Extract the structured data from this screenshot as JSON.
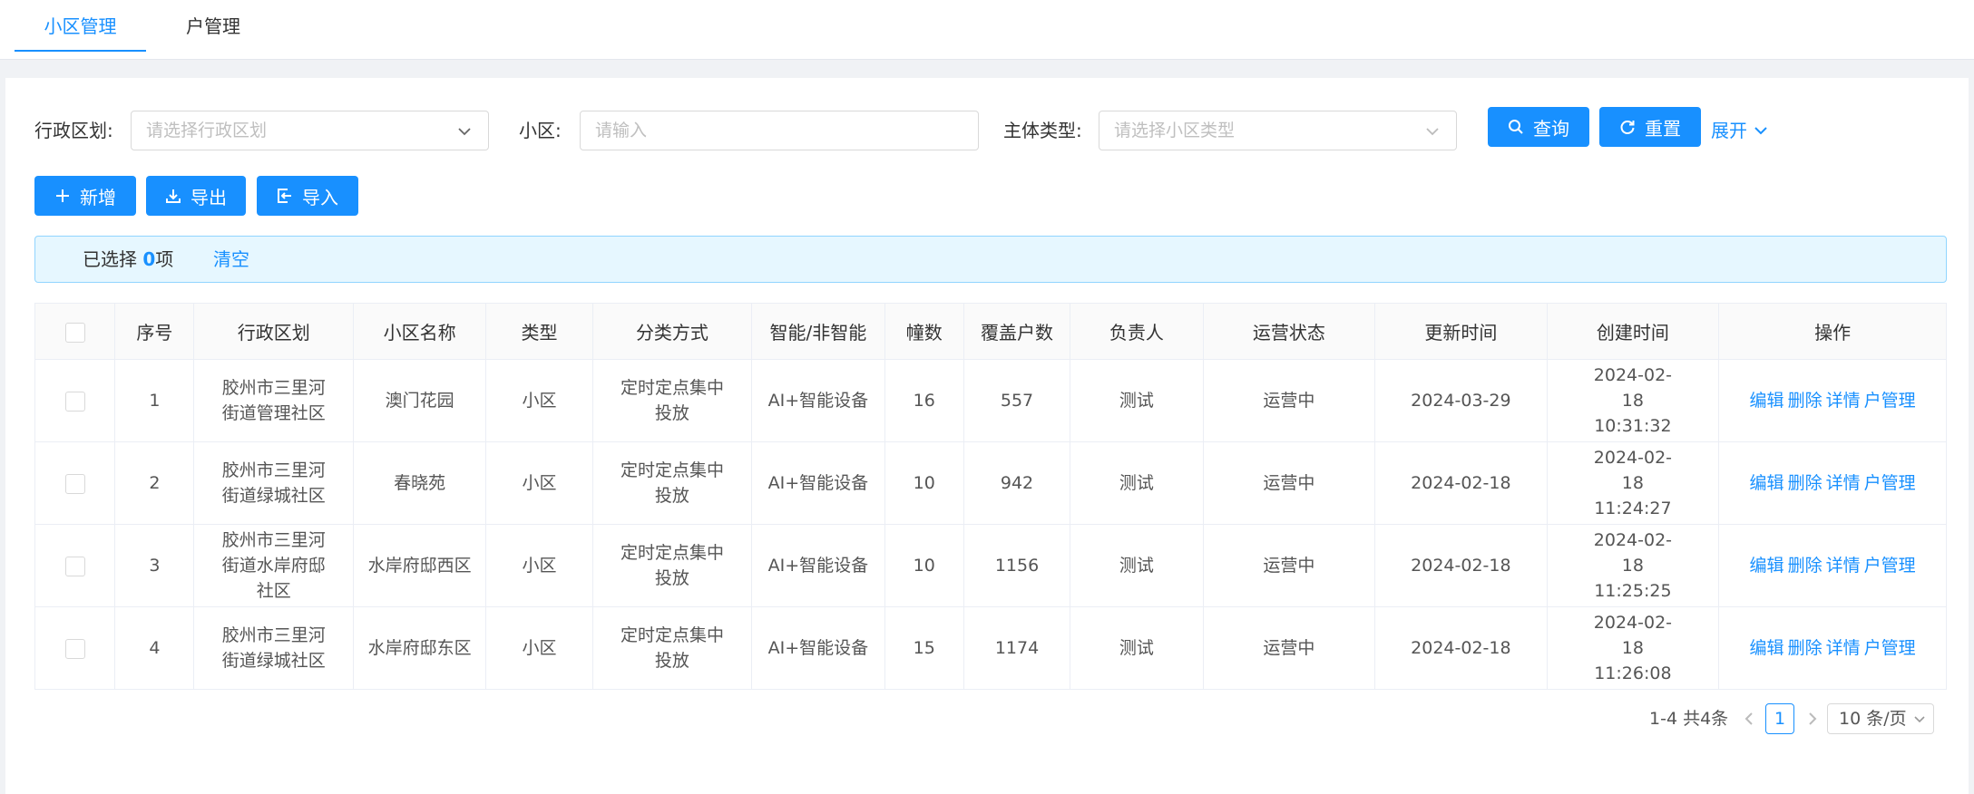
{
  "tabs": [
    {
      "label": "小区管理",
      "active": true
    },
    {
      "label": "户管理",
      "active": false
    }
  ],
  "filters": {
    "district_label": "行政区划:",
    "district_placeholder": "请选择行政区划",
    "community_label": "小区:",
    "community_placeholder": "请输入",
    "type_label": "主体类型:",
    "type_placeholder": "请选择小区类型",
    "query_label": "查询",
    "reset_label": "重置",
    "expand_label": "展开"
  },
  "toolbar": {
    "add_label": "新增",
    "export_label": "导出",
    "import_label": "导入"
  },
  "selection": {
    "prefix": "已选择 ",
    "count": "0",
    "suffix": "项",
    "clear_label": "清空"
  },
  "table": {
    "headers": [
      "序号",
      "行政区划",
      "小区名称",
      "类型",
      "分类方式",
      "智能/非智能",
      "幢数",
      "覆盖户数",
      "负责人",
      "运营状态",
      "更新时间",
      "创建时间",
      "操作"
    ],
    "rows": [
      {
        "no": "1",
        "district": "胶州市三里河街道管理社区",
        "name": "澳门花园",
        "type": "小区",
        "method": "定时定点集中投放",
        "smart": "AI+智能设备",
        "buildings": "16",
        "households": "557",
        "owner": "测试",
        "status": "运营中",
        "updated": "2024-03-29",
        "created": "2024-02-18 10:31:32"
      },
      {
        "no": "2",
        "district": "胶州市三里河街道绿城社区",
        "name": "春晓苑",
        "type": "小区",
        "method": "定时定点集中投放",
        "smart": "AI+智能设备",
        "buildings": "10",
        "households": "942",
        "owner": "测试",
        "status": "运营中",
        "updated": "2024-02-18",
        "created": "2024-02-18 11:24:27"
      },
      {
        "no": "3",
        "district": "胶州市三里河街道水岸府邸社区",
        "name": "水岸府邸西区",
        "type": "小区",
        "method": "定时定点集中投放",
        "smart": "AI+智能设备",
        "buildings": "10",
        "households": "1156",
        "owner": "测试",
        "status": "运营中",
        "updated": "2024-02-18",
        "created": "2024-02-18 11:25:25"
      },
      {
        "no": "4",
        "district": "胶州市三里河街道绿城社区",
        "name": "水岸府邸东区",
        "type": "小区",
        "method": "定时定点集中投放",
        "smart": "AI+智能设备",
        "buildings": "15",
        "households": "1174",
        "owner": "测试",
        "status": "运营中",
        "updated": "2024-02-18",
        "created": "2024-02-18 11:26:08"
      }
    ],
    "actions": [
      "编辑",
      "删除",
      "详情",
      "户管理"
    ]
  },
  "pagination": {
    "total_text": "1-4 共4条",
    "current_page": "1",
    "page_size": "10 条/页"
  },
  "colors": {
    "primary": "#1890ff",
    "alert_bg": "#e6f7ff"
  }
}
